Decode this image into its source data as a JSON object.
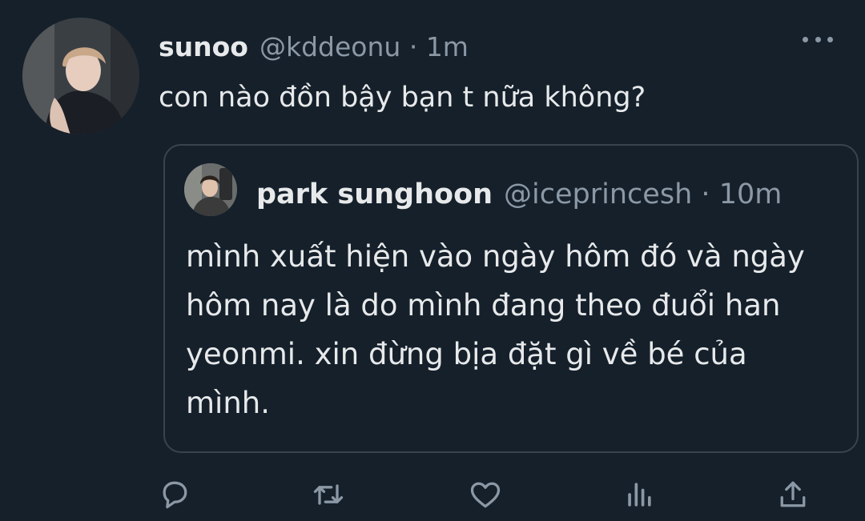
{
  "tweet": {
    "display_name": "sunoo",
    "handle": "@kddeonu",
    "separator": "·",
    "time": "1m",
    "text": "con nào đồn bậy bạn t nữa không?"
  },
  "quoted_tweet": {
    "display_name": "park sunghoon",
    "handle": "@iceprincesh",
    "separator": "·",
    "time": "10m",
    "text": "mình xuất hiện vào ngày hôm đó và ngày hôm nay là do mình đang theo đuổi han yeonmi. xin đừng bịa đặt gì về bé của mình."
  },
  "icons": {
    "more": "more-horizontal-icon",
    "reply": "reply-icon",
    "retweet": "retweet-icon",
    "like": "heart-icon",
    "analytics": "analytics-icon",
    "share": "share-icon"
  },
  "colors": {
    "background": "#15202b",
    "text_primary": "#e7e9ea",
    "text_secondary": "#8b98a5",
    "border": "#38444d"
  }
}
